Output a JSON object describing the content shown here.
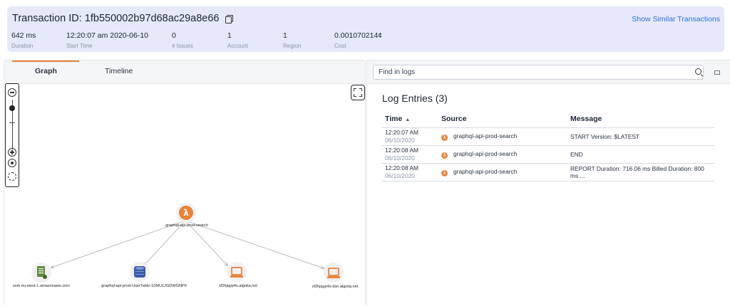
{
  "header": {
    "transaction_label": "Transaction ID: 1fb550002b97d68ac29a8e66",
    "similar_link": "Show Similar Transactions",
    "metrics": [
      {
        "value": "642 ms",
        "label": "Duration"
      },
      {
        "value": "12:20:07 am 2020-06-10",
        "label": "Start Time"
      },
      {
        "value": "0",
        "label": "# Issues"
      },
      {
        "value": "1",
        "label": "Account"
      },
      {
        "value": "1",
        "label": "Region"
      },
      {
        "value": "0.001070214¢",
        "label": "Cost"
      }
    ]
  },
  "tabs": [
    {
      "label": "Graph",
      "active": true
    },
    {
      "label": "Timeline",
      "active": false
    }
  ],
  "graph": {
    "root": {
      "label": "graphql-api-prod-search",
      "icon": "lambda-icon",
      "color": "#e8833a"
    },
    "children": [
      {
        "label": "ssm.eu-west-1.amazonaws.com",
        "icon": "document-icon",
        "color": "#5e8a3f"
      },
      {
        "label": "graphql-api-prod-UserTable-10MU1JGDWGNP6",
        "icon": "database-icon",
        "color": "#3b5aa8"
      },
      {
        "label": "sf2hjqyp4s.algolia.net",
        "icon": "server-icon",
        "color": "#e8833a"
      },
      {
        "label": "sf2hjqyp4s-dsn.algolia.net",
        "icon": "server-icon",
        "color": "#e8833a"
      }
    ]
  },
  "logs": {
    "search_placeholder": "Find in logs",
    "title": "Log Entries (3)",
    "columns": [
      "Time",
      "Source",
      "Message"
    ],
    "rows": [
      {
        "time": "12:20:07 AM",
        "date": "06/10/2020",
        "source": "graphql-api-prod-search",
        "message": "START Version: $LATEST"
      },
      {
        "time": "12:20:08 AM",
        "date": "06/10/2020",
        "source": "graphql-api-prod-search",
        "message": "END"
      },
      {
        "time": "12:20:08 AM",
        "date": "06/10/2020",
        "source": "graphql-api-prod-search",
        "message": "REPORT Duration: 716.06 ms Billed Duration: 800 ms ..."
      }
    ]
  },
  "colors": {
    "accent": "#e8833a",
    "link": "#2f6fd9",
    "header_bg": "#e6e9f9"
  }
}
